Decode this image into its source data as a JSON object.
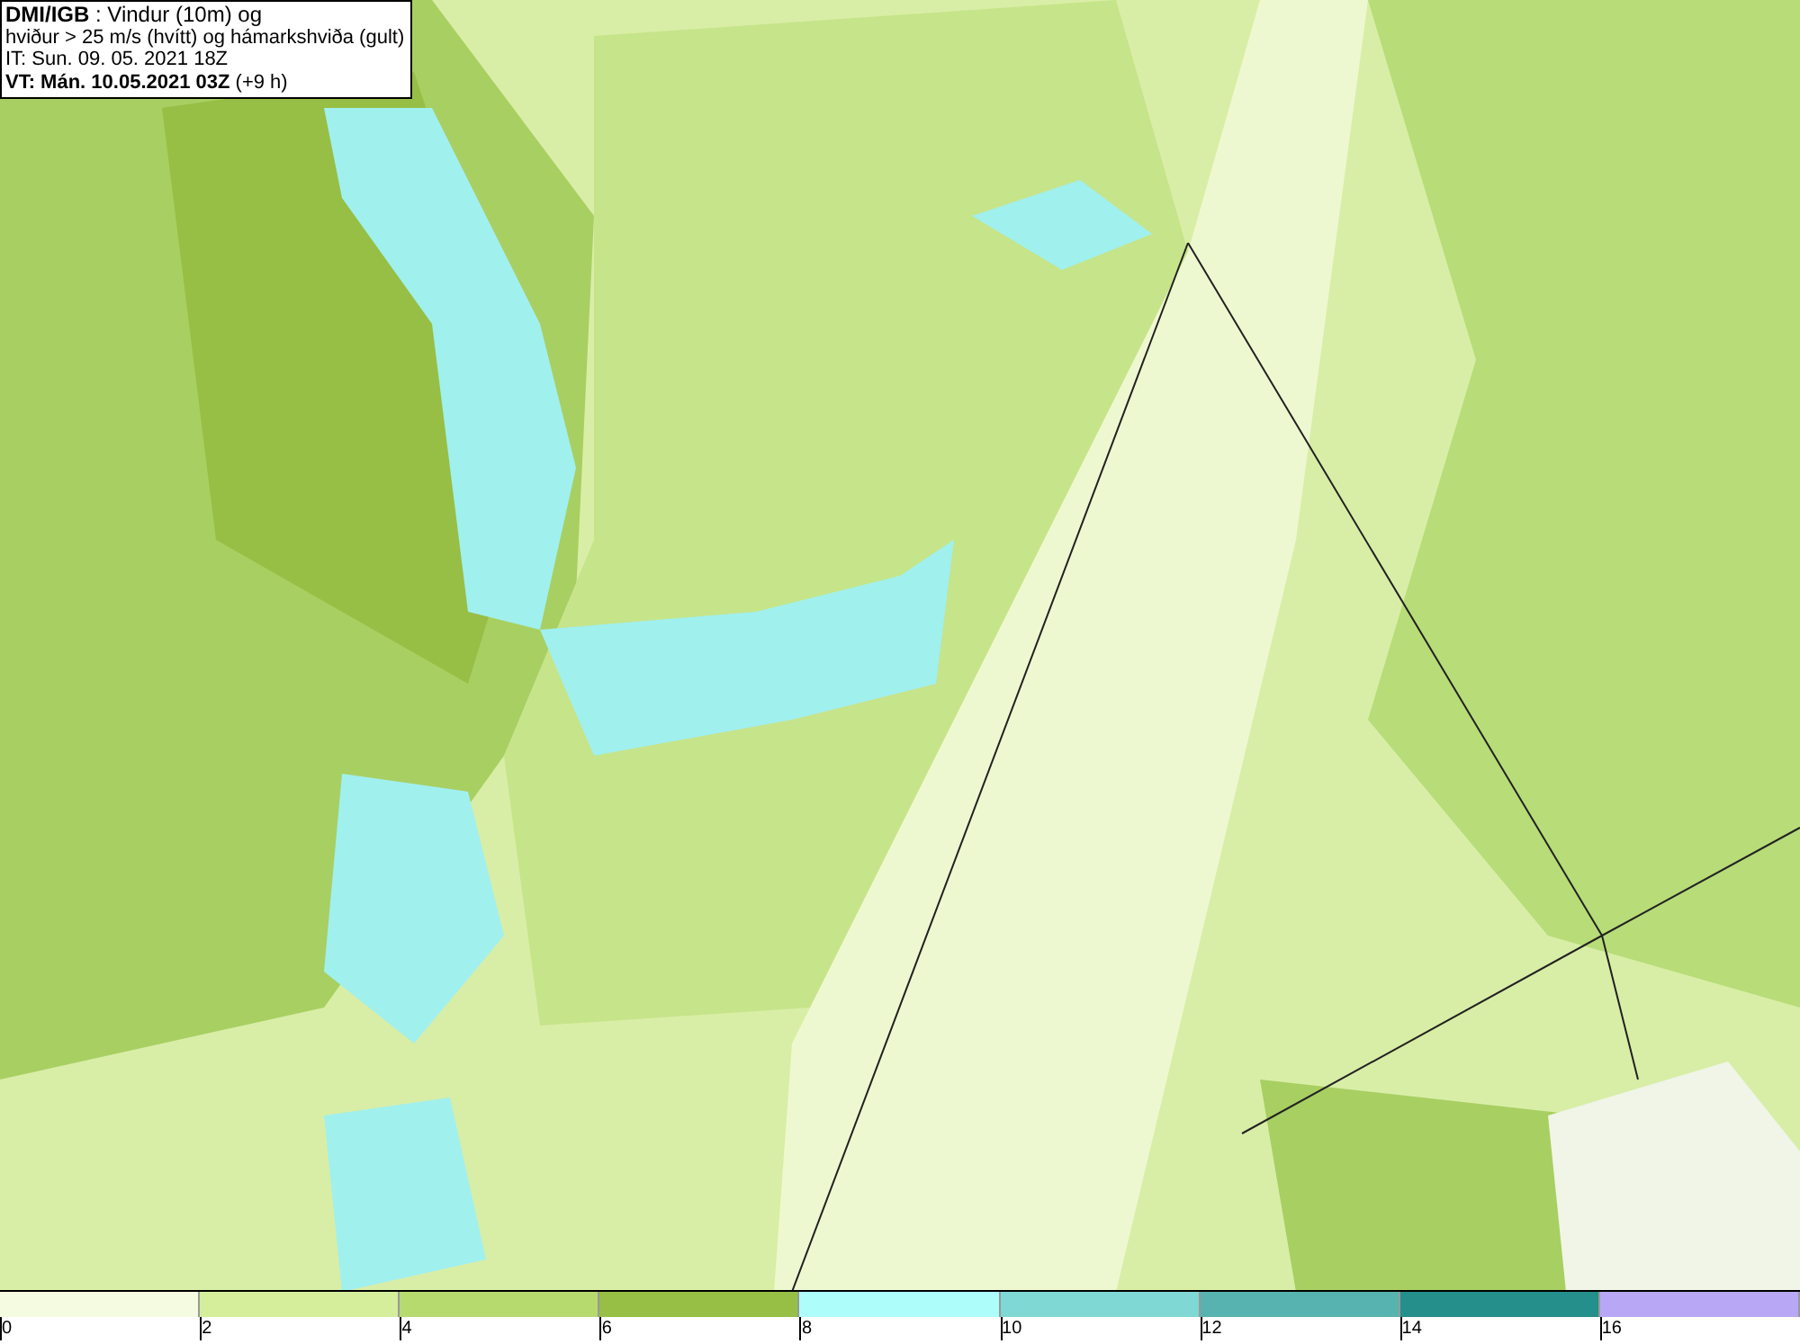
{
  "info": {
    "lines": [
      "**DMI/IGB** : Vindur (10m) og",
      "hviður > 25 m/s (hvítt) og hámarkshviða (gult)",
      "IT: Sun. 09. 05. 2021 18Z",
      "**VT: Mán. 10.05.2021 03Z** (+9 h)"
    ]
  },
  "legend": [
    {
      "label": "0",
      "color": "#f5fbe0"
    },
    {
      "label": "2",
      "color": "#d4ee9c"
    },
    {
      "label": "4",
      "color": "#b7da6e"
    },
    {
      "label": "6",
      "color": "#97bf45"
    },
    {
      "label": "8",
      "color": "#adfdfb"
    },
    {
      "label": "10",
      "color": "#7fd8d4"
    },
    {
      "label": "12",
      "color": "#56b3b0"
    },
    {
      "label": "14",
      "color": "#248f8b"
    },
    {
      "label": "16",
      "color": "#b8a7f5"
    }
  ]
}
